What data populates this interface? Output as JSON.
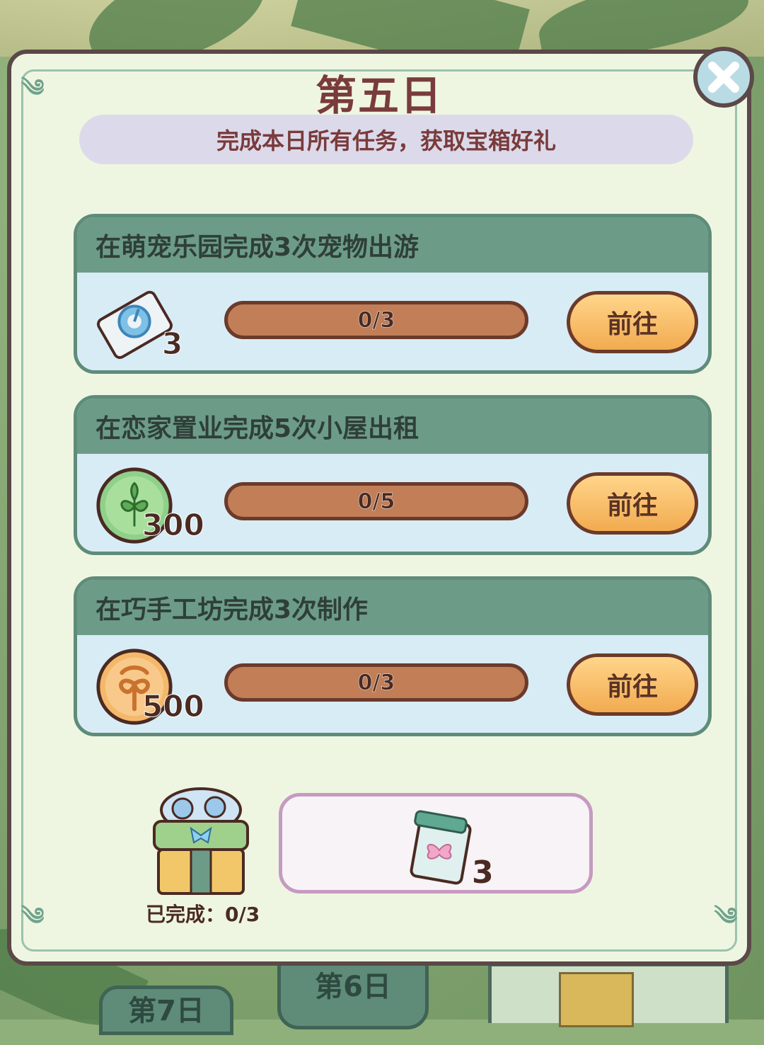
{
  "modal": {
    "title": "第五日",
    "subtitle": "完成本日所有任务，获取宝箱好礼"
  },
  "tasks": [
    {
      "title": "在萌宠乐园完成3次宠物出游",
      "reward_icon": "ticket-icon",
      "reward_count": "3",
      "progress_text": "0/3",
      "progress_fraction": 0,
      "button_label": "前往"
    },
    {
      "title": "在恋家置业完成5次小屋出租",
      "reward_icon": "green-leaf-coin-icon",
      "reward_count": "300",
      "progress_text": "0/5",
      "progress_fraction": 0,
      "button_label": "前往"
    },
    {
      "title": "在巧手工坊完成3次制作",
      "reward_icon": "orange-leaf-coin-icon",
      "reward_count": "500",
      "progress_text": "0/3",
      "progress_fraction": 0,
      "button_label": "前往"
    }
  ],
  "chest": {
    "status": "已完成：0/3",
    "reward_icon": "butterfly-scroll-icon",
    "reward_count": "3"
  },
  "background_tabs": {
    "day6": "第6日",
    "day7": "第7日"
  },
  "colors": {
    "title": "#7a3b3b",
    "card_header": "#6c9c88",
    "button": "#f2ab50",
    "progress_track": "#c17e57"
  }
}
